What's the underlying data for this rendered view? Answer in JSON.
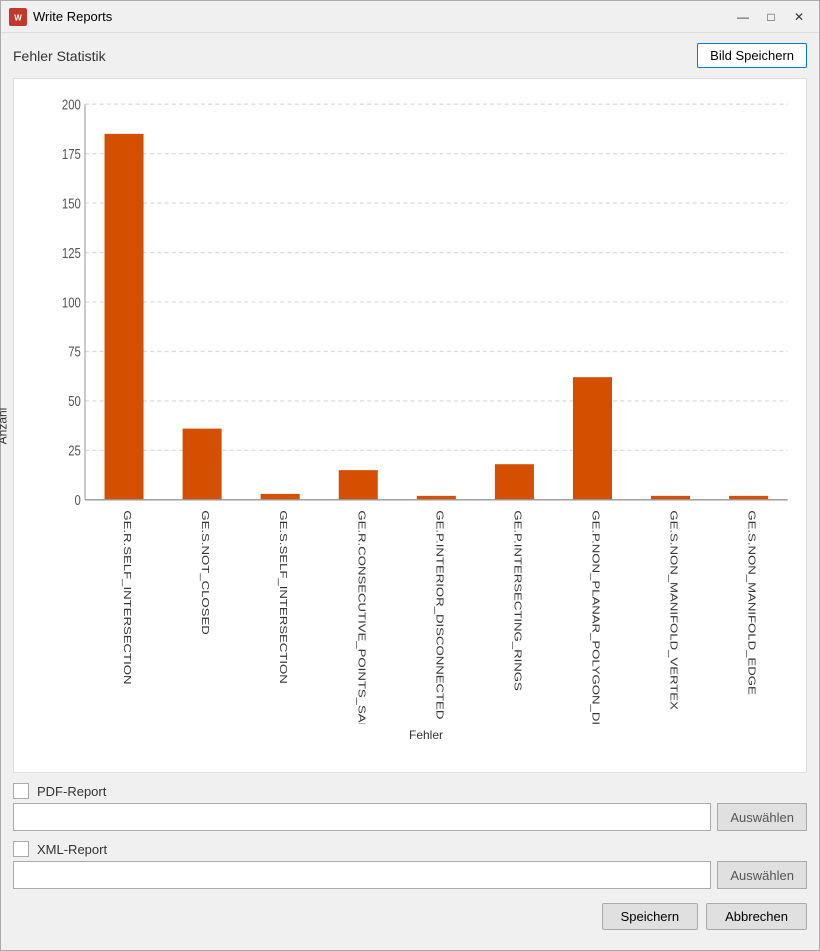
{
  "window": {
    "title": "Write Reports",
    "icon": "📊"
  },
  "titlebar": {
    "minimize_label": "—",
    "maximize_label": "□",
    "close_label": "✕"
  },
  "header": {
    "chart_title": "Fehler Statistik",
    "save_image_label": "Bild Speichern"
  },
  "chart": {
    "y_axis_label": "Anzahl",
    "x_axis_label": "Fehler",
    "y_ticks": [
      0,
      25,
      50,
      75,
      100,
      125,
      150,
      175,
      200
    ],
    "bars": [
      {
        "label": "GE.R.SELF_INTERSECTION",
        "value": 185
      },
      {
        "label": "GE.S.NOT_CLOSED",
        "value": 36
      },
      {
        "label": "GE.S.SELF_INTERSECTION",
        "value": 3
      },
      {
        "label": "GE.R.CONSECUTIVE_POINTS_SAME",
        "value": 15
      },
      {
        "label": "GE.P.INTERIOR_DISCONNECTED",
        "value": 2
      },
      {
        "label": "GE.P.INTERSECTING_RINGS",
        "value": 18
      },
      {
        "label": "GE.P.NON_PLANAR_POLYGON_DISTANCE_PLANE",
        "value": 62
      },
      {
        "label": "GE.S.NON_MANIFOLD_VERTEX",
        "value": 2
      },
      {
        "label": "GE.S.NON_MANIFOLD_EDGE",
        "value": 2
      }
    ],
    "bar_color": "#d45000",
    "max_value": 200,
    "grid_color": "#ddd"
  },
  "pdf_report": {
    "checkbox_label": "PDF-Report",
    "auswahlen_label": "Auswählen",
    "input_placeholder": ""
  },
  "xml_report": {
    "checkbox_label": "XML-Report",
    "auswahlen_label": "Auswählen",
    "input_placeholder": ""
  },
  "actions": {
    "save_label": "Speichern",
    "cancel_label": "Abbrechen"
  }
}
